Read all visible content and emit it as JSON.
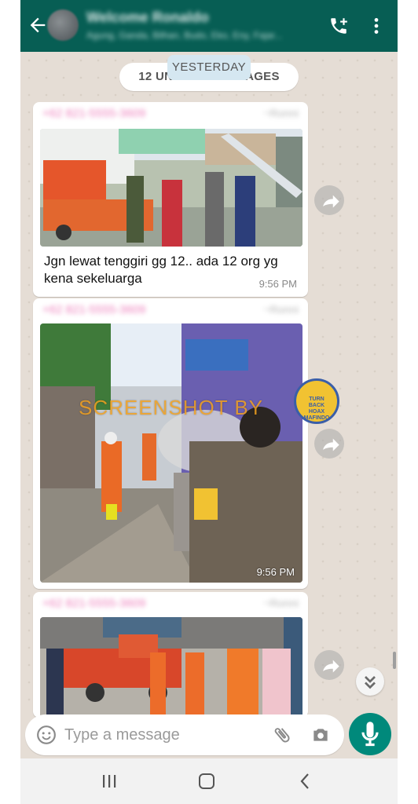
{
  "header": {
    "contact_name": "Welcome Ronaldo",
    "contact_subtitle": "Agung, Ganda, Bilhan, Budo, Eko, Eny, Fajar...",
    "call_icon": "add-call-icon",
    "menu_icon": "more-vert-icon"
  },
  "chat": {
    "unread_label": "12 UNREAD MESSAGES",
    "date_label": "YESTERDAY",
    "messages": [
      {
        "sender_number": "+62 821-5555-3609",
        "sender_name": "~Ronni",
        "image": "photo-spraying-crew-truck",
        "caption": "Jgn lewat tenggiri gg 12.. ada 12 org yg kena sekeluarga",
        "time": "9:56 PM"
      },
      {
        "sender_number": "+62 821-5555-3609",
        "sender_name": "~Ronni",
        "image": "photo-disinfectant-spraying-alley",
        "time": "9:56 PM"
      },
      {
        "sender_number": "+62 821-5555-3609",
        "sender_name": "~Ronni",
        "image": "photo-orange-truck-crew"
      }
    ],
    "watermark": "SCREENSHOT BY",
    "badge": {
      "line1": "TURN",
      "line2": "BACK",
      "line3": "HOAX",
      "org": "MAFINDO"
    }
  },
  "input": {
    "placeholder": "Type a message"
  }
}
